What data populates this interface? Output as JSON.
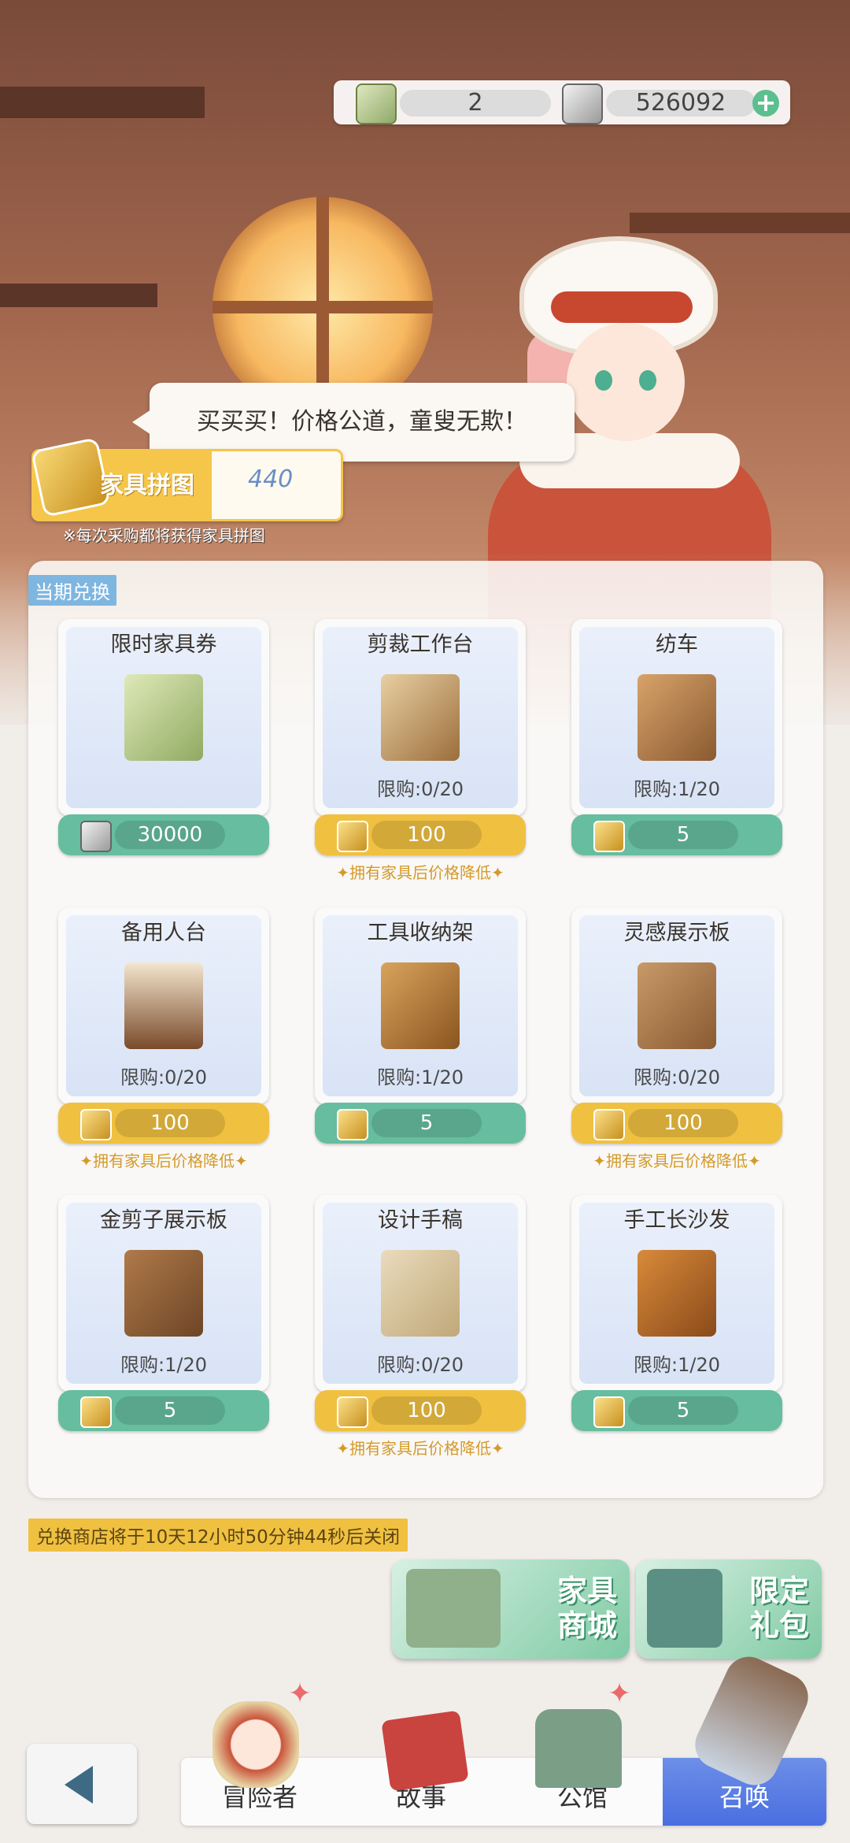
{
  "currency": {
    "tickets": "2",
    "coins": "526092",
    "add_label": "+"
  },
  "dialog": "买买买！价格公道，童叟无欺！",
  "puzzle": {
    "label": "家具拼图",
    "value": "440",
    "note": "※每次采购都将获得家具拼图"
  },
  "section_title": "当期兑换",
  "items": [
    {
      "name": "限时家具券",
      "limit": "",
      "price": "30000",
      "currency": "ticket-icon",
      "discount": ""
    },
    {
      "name": "剪裁工作台",
      "limit": "限购:0/20",
      "price": "100",
      "currency": "puzzle-icon",
      "discount": "✦拥有家具后价格降低✦"
    },
    {
      "name": "纺车",
      "limit": "限购:1/20",
      "price": "5",
      "currency": "puzzle-icon",
      "discount": ""
    },
    {
      "name": "备用人台",
      "limit": "限购:0/20",
      "price": "100",
      "currency": "puzzle-icon",
      "discount": "✦拥有家具后价格降低✦"
    },
    {
      "name": "工具收纳架",
      "limit": "限购:1/20",
      "price": "5",
      "currency": "puzzle-icon",
      "discount": ""
    },
    {
      "name": "灵感展示板",
      "limit": "限购:0/20",
      "price": "100",
      "currency": "puzzle-icon",
      "discount": "✦拥有家具后价格降低✦"
    },
    {
      "name": "金剪子展示板",
      "limit": "限购:1/20",
      "price": "5",
      "currency": "puzzle-icon",
      "discount": ""
    },
    {
      "name": "设计手稿",
      "limit": "限购:0/20",
      "price": "100",
      "currency": "puzzle-icon",
      "discount": "✦拥有家具后价格降低✦"
    },
    {
      "name": "手工长沙发",
      "limit": "限购:1/20",
      "price": "5",
      "currency": "puzzle-icon",
      "discount": ""
    }
  ],
  "closing_notice": "兑换商店将于10天12小时50分钟44秒后关闭",
  "shops": {
    "furniture": "家具\n商城",
    "gift": "限定\n礼包"
  },
  "nav": {
    "adventurer": "冒险者",
    "story": "故事",
    "guild": "公馆",
    "summon": "召唤"
  },
  "colors": {
    "green": "#66bda0",
    "yellow": "#f0c040",
    "summon": "#4a6ee0"
  }
}
